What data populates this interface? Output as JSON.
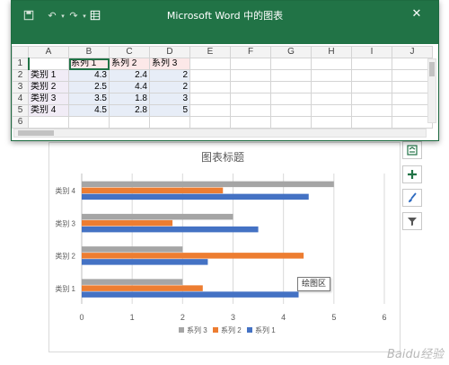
{
  "window": {
    "title": "Microsoft Word 中的图表",
    "close_icon": "close-icon",
    "save_icon": "save-icon",
    "undo_icon": "undo-icon",
    "redo_icon": "redo-icon",
    "sheet_icon": "spreadsheet-icon"
  },
  "sheet": {
    "columns": [
      "A",
      "B",
      "C",
      "D",
      "E",
      "F",
      "G",
      "H",
      "I",
      "J"
    ],
    "rows": [
      {
        "num": "1",
        "cells": [
          "",
          "系列 1",
          "系列 2",
          "系列 3"
        ]
      },
      {
        "num": "2",
        "cells": [
          "类别 1",
          "4.3",
          "2.4",
          "2"
        ]
      },
      {
        "num": "3",
        "cells": [
          "类别 2",
          "2.5",
          "4.4",
          "2"
        ]
      },
      {
        "num": "4",
        "cells": [
          "类别 3",
          "3.5",
          "1.8",
          "3"
        ]
      },
      {
        "num": "5",
        "cells": [
          "类别 4",
          "4.5",
          "2.8",
          "5"
        ]
      },
      {
        "num": "6",
        "cells": [
          "",
          "",
          "",
          ""
        ]
      }
    ]
  },
  "tooltip": "绘图区",
  "watermark": "Baidu经验",
  "colors": {
    "excel_green": "#217346",
    "series1": "#4472c4",
    "series2": "#ed7d31",
    "series3": "#a5a5a5"
  },
  "chart_data": {
    "type": "bar",
    "orientation": "horizontal",
    "title": "图表标题",
    "categories": [
      "类别 1",
      "类别 2",
      "类别 3",
      "类别 4"
    ],
    "series": [
      {
        "name": "系列 1",
        "values": [
          4.3,
          2.5,
          3.5,
          4.5
        ],
        "color": "#4472c4"
      },
      {
        "name": "系列 2",
        "values": [
          2.4,
          4.4,
          1.8,
          2.8
        ],
        "color": "#ed7d31"
      },
      {
        "name": "系列 3",
        "values": [
          2,
          2,
          3,
          5
        ],
        "color": "#a5a5a5"
      }
    ],
    "xlim": [
      0,
      6
    ],
    "xticks": [
      "0",
      "1",
      "2",
      "3",
      "4",
      "5",
      "6"
    ],
    "grid": true,
    "legend": "bottom",
    "legend_order": [
      "系列 3",
      "系列 2",
      "系列 1"
    ]
  }
}
